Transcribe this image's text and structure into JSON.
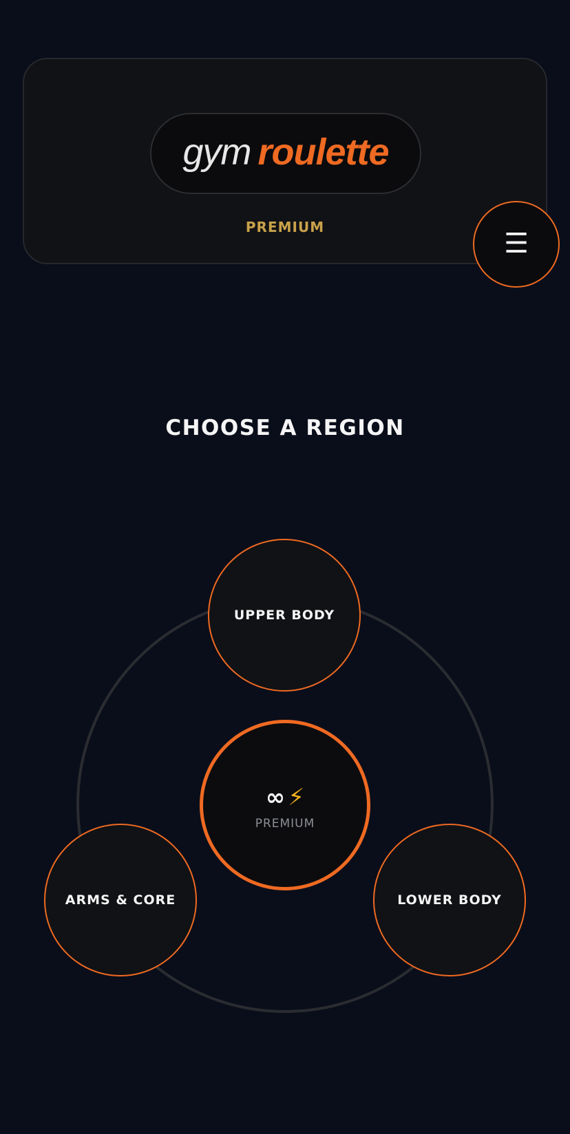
{
  "header": {
    "logo": {
      "word1": "gym",
      "word2": "roulette"
    },
    "tier_label": "PREMIUM",
    "menu_icon": "hamburger-menu-icon",
    "menu_glyph": "☰"
  },
  "main": {
    "title": "CHOOSE A REGION",
    "regions": [
      {
        "label": "UPPER BODY"
      },
      {
        "label": "ARMS & CORE"
      },
      {
        "label": "LOWER BODY"
      }
    ],
    "center": {
      "infinity_glyph": "∞",
      "infinity_icon": "infinity-icon",
      "bolt_glyph": "⚡",
      "bolt_icon": "lightning-bolt-icon",
      "label": "PREMIUM"
    }
  },
  "colors": {
    "background": "#0a0e1a",
    "card": "#111215",
    "accent": "#ef6a22",
    "premium_gold": "#c9a24a",
    "bolt_yellow": "#f2b21c",
    "muted_text": "#8c8f96"
  }
}
